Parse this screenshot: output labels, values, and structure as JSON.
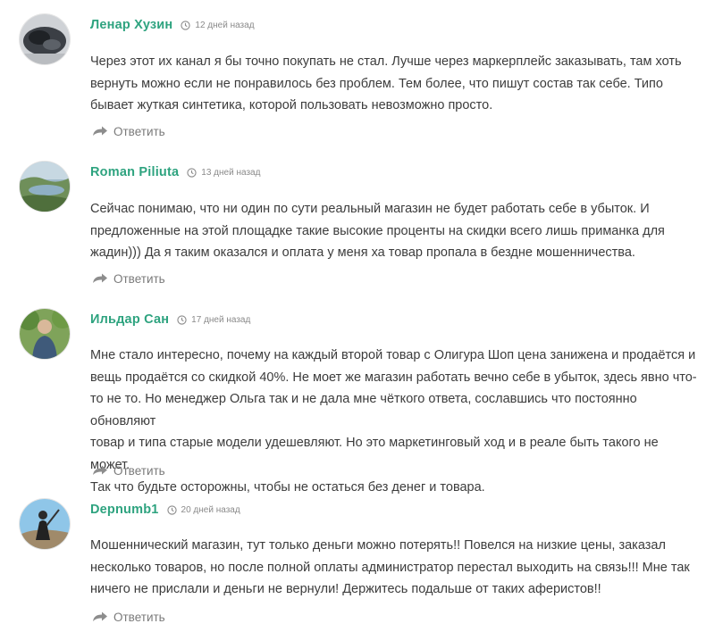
{
  "comments": [
    {
      "author": "Ленар Хузин",
      "date": "12 дней назад",
      "text": "Через этот их канал я бы точно покупать не стал. Лучше через маркерплейс заказывать, там хоть\nвернуть можно если не понравилось без проблем. Тем более, что пишут состав так себе. Типо\nбывает жуткая синтетика, которой пользовать невозможно просто.",
      "reply_label": "Ответить"
    },
    {
      "author": "Roman Piliuta",
      "date": "13 дней назад",
      "text": "Сейчас понимаю, что ни один по сути реальный магазин не будет работать себе в убыток. И\nпредложенные на этой площадке такие высокие проценты на скидки всего лишь приманка для\nжадин))) Да я таким оказался и оплата у меня ха товар пропала в бездне мошенничества.",
      "reply_label": "Ответить"
    },
    {
      "author": "Ильдар Сан",
      "date": "17 дней назад",
      "text": "Мне стало интересно, почему на каждый второй товар с Олигура Шоп цена занижена и продаётся и\nвещь продаётся со скидкой 40%. Не моет же магазин работать вечно себе в убыток, здесь явно что-\nто не то. Но менеджер Ольга так и не дала мне чёткого ответа, сославшись что постоянно обновляют\nтовар и типа старые модели удешевляют. Но это маркетинговый ход и в реале быть такого не может.\nТак что будьте осторожны, чтобы не остаться без денег и товара.",
      "reply_label": "Ответить"
    },
    {
      "author": "Depnumb1",
      "date": "20 дней назад",
      "text": "Мошеннический магазин, тут только деньги можно потерять!! Повелся на низкие цены, заказал\nнесколько товаров, но после полной оплаты администратор перестал выходить на связь!!! Мне так\nничего не прислали и деньги не вернули! Держитесь подальше от таких аферистов!!",
      "reply_label": "Ответить"
    }
  ],
  "icons": {
    "clock": "clock-icon",
    "reply": "reply-arrow-icon"
  },
  "colors": {
    "author": "#2ea37f",
    "date": "#8a8a8a",
    "text": "#3c3c3c",
    "reply": "#7a7a7a"
  }
}
